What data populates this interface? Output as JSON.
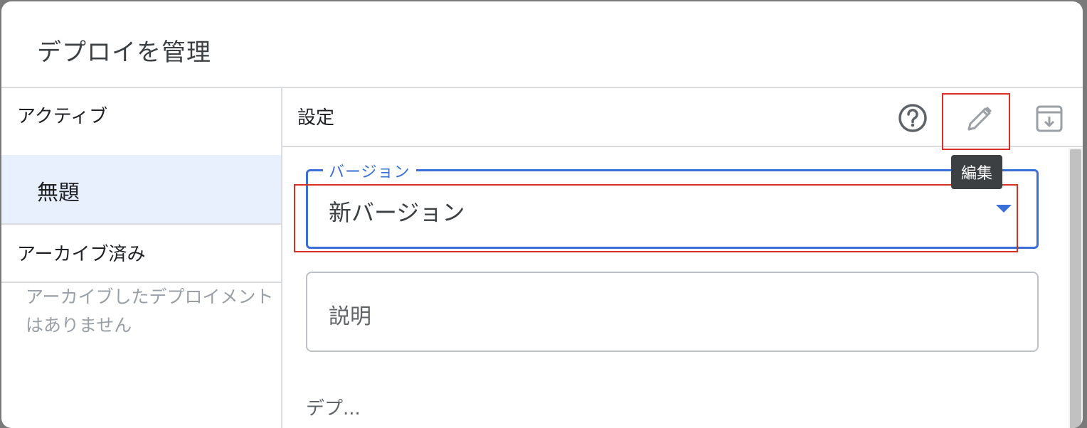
{
  "dialog": {
    "title": "デプロイを管理"
  },
  "sidebar": {
    "active_header": "アクティブ",
    "active_items": [
      {
        "label": "無題"
      }
    ],
    "archived_header": "アーカイブ済み",
    "archived_empty": "アーカイブしたデプロイメントはありません"
  },
  "settings": {
    "title": "設定",
    "icons": {
      "help": "help-circle-icon",
      "edit": "pencil-icon",
      "archive": "archive-icon"
    },
    "edit_tooltip": "編集",
    "version_field": {
      "label": "バージョン",
      "value": "新バージョン"
    },
    "description_field": {
      "placeholder": "説明"
    },
    "next_section_label": "デプ..."
  },
  "colors": {
    "accent": "#3b6fd8",
    "highlight_box": "#d93025",
    "active_bg": "#e8f0fe"
  }
}
